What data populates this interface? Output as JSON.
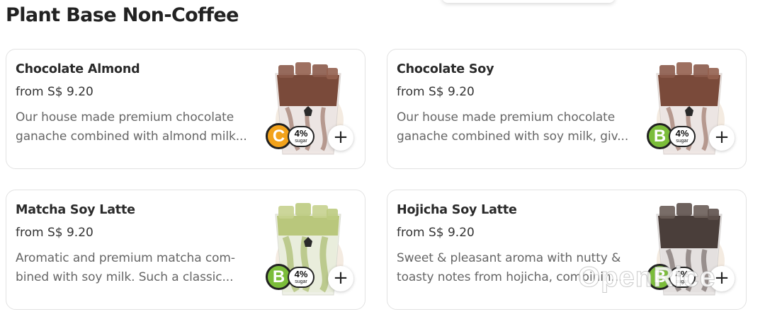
{
  "section": {
    "title": "Plant Base Non-Coffee"
  },
  "products": [
    {
      "name": "Chocolate Almond",
      "price": "from S$ 9.20",
      "desc_line1": "Our house made premium chocolate",
      "desc_line2": "ganache combined with almond milk...",
      "grade": "C",
      "sugar_pct": "4%",
      "sugar_label": "sugar",
      "add_label": "+",
      "drink_color": "#7a4a3a"
    },
    {
      "name": "Chocolate Soy",
      "price": "from S$ 9.20",
      "desc_line1": "Our house made premium chocolate",
      "desc_line2": "ganache combined with soy milk, giv...",
      "grade": "B",
      "sugar_pct": "4%",
      "sugar_label": "sugar",
      "add_label": "+",
      "drink_color": "#7a4a3a"
    },
    {
      "name": "Matcha Soy Latte",
      "price": "from S$ 9.20",
      "desc_line1": "Aromatic and premium matcha com-",
      "desc_line2": "bined with soy milk. Such a classic...",
      "grade": "B",
      "sugar_pct": "4%",
      "sugar_label": "sugar",
      "add_label": "+",
      "drink_color": "#9fb35a"
    },
    {
      "name": "Hojicha Soy Latte",
      "price": "from S$ 9.20",
      "desc_line1": "Sweet & pleasant aroma with nutty &",
      "desc_line2": "toasty notes from hojicha, combinin...",
      "grade": "B",
      "sugar_pct": "4%",
      "sugar_label": "sugar",
      "add_label": "+",
      "drink_color": "#4a3e3a"
    }
  ],
  "watermark": "OpenRice",
  "colors": {
    "grade_c": "#f2a21b",
    "grade_b": "#7bbd3a",
    "card_border": "#e2e2e2"
  }
}
